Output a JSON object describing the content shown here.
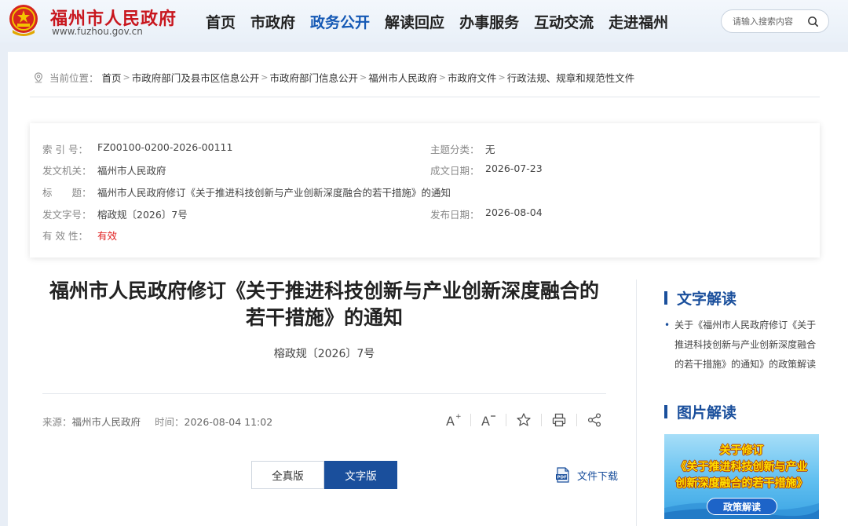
{
  "header": {
    "site_name": "福州市人民政府",
    "site_url": "www.fuzhou.gov.cn",
    "nav": [
      "首页",
      "市政府",
      "政务公开",
      "解读回应",
      "办事服务",
      "互动交流",
      "走进福州"
    ],
    "active_nav_index": 2,
    "search_placeholder": "请输入搜索内容"
  },
  "breadcrumb": {
    "label": "当前位置：",
    "items": [
      "首页",
      "市政府部门及县市区信息公开",
      "市政府部门信息公开",
      "福州市人民政府",
      "市政府文件",
      "行政法规、规章和规范性文件"
    ]
  },
  "meta": {
    "index_no_label": "索 引 号：",
    "index_no": "FZ00100-0200-2026-00111",
    "topic_label": "主题分类：",
    "topic": "无",
    "issuer_label": "发文机关：",
    "issuer": "福州市人民政府",
    "written_date_label": "成文日期：",
    "written_date": "2026-07-23",
    "title_label": "标　　题：",
    "title": "福州市人民政府修订《关于推进科技创新与产业创新深度融合的若干措施》的通知",
    "doc_no_label": "发文字号：",
    "doc_no": "榕政规〔2026〕7号",
    "publish_date_label": "发布日期：",
    "publish_date": "2026-08-04",
    "validity_label": "有 效 性：",
    "validity": "有效"
  },
  "article": {
    "title_line1": "福州市人民政府修订《关于推进科技创新与产业创新深度融合的",
    "title_line2": "若干措施》的通知",
    "doc_no": "榕政规〔2026〕7号",
    "source_label": "来源：",
    "source": "福州市人民政府",
    "time_label": "时间：",
    "time": "2026-08-04 11:02",
    "btn_full": "全真版",
    "btn_text": "文字版",
    "download": "文件下载"
  },
  "sidebar": {
    "text_interp_title": "文字解读",
    "text_interp_item": "关于《福州市人民政府修订《关于推进科技创新与产业创新深度融合的若干措施》的通知》的政策解读",
    "image_interp_title": "图片解读",
    "banner_top": "关于修订",
    "banner_line1": "《关于推进科技创新与产业",
    "banner_line2": "创新深度融合的若干措施》",
    "banner_button": "政策解读"
  },
  "colors": {
    "brand_red": "#c8161e",
    "accent_blue": "#1a4f9c",
    "active_nav": "#1559b5",
    "valid_red": "#e02020"
  }
}
